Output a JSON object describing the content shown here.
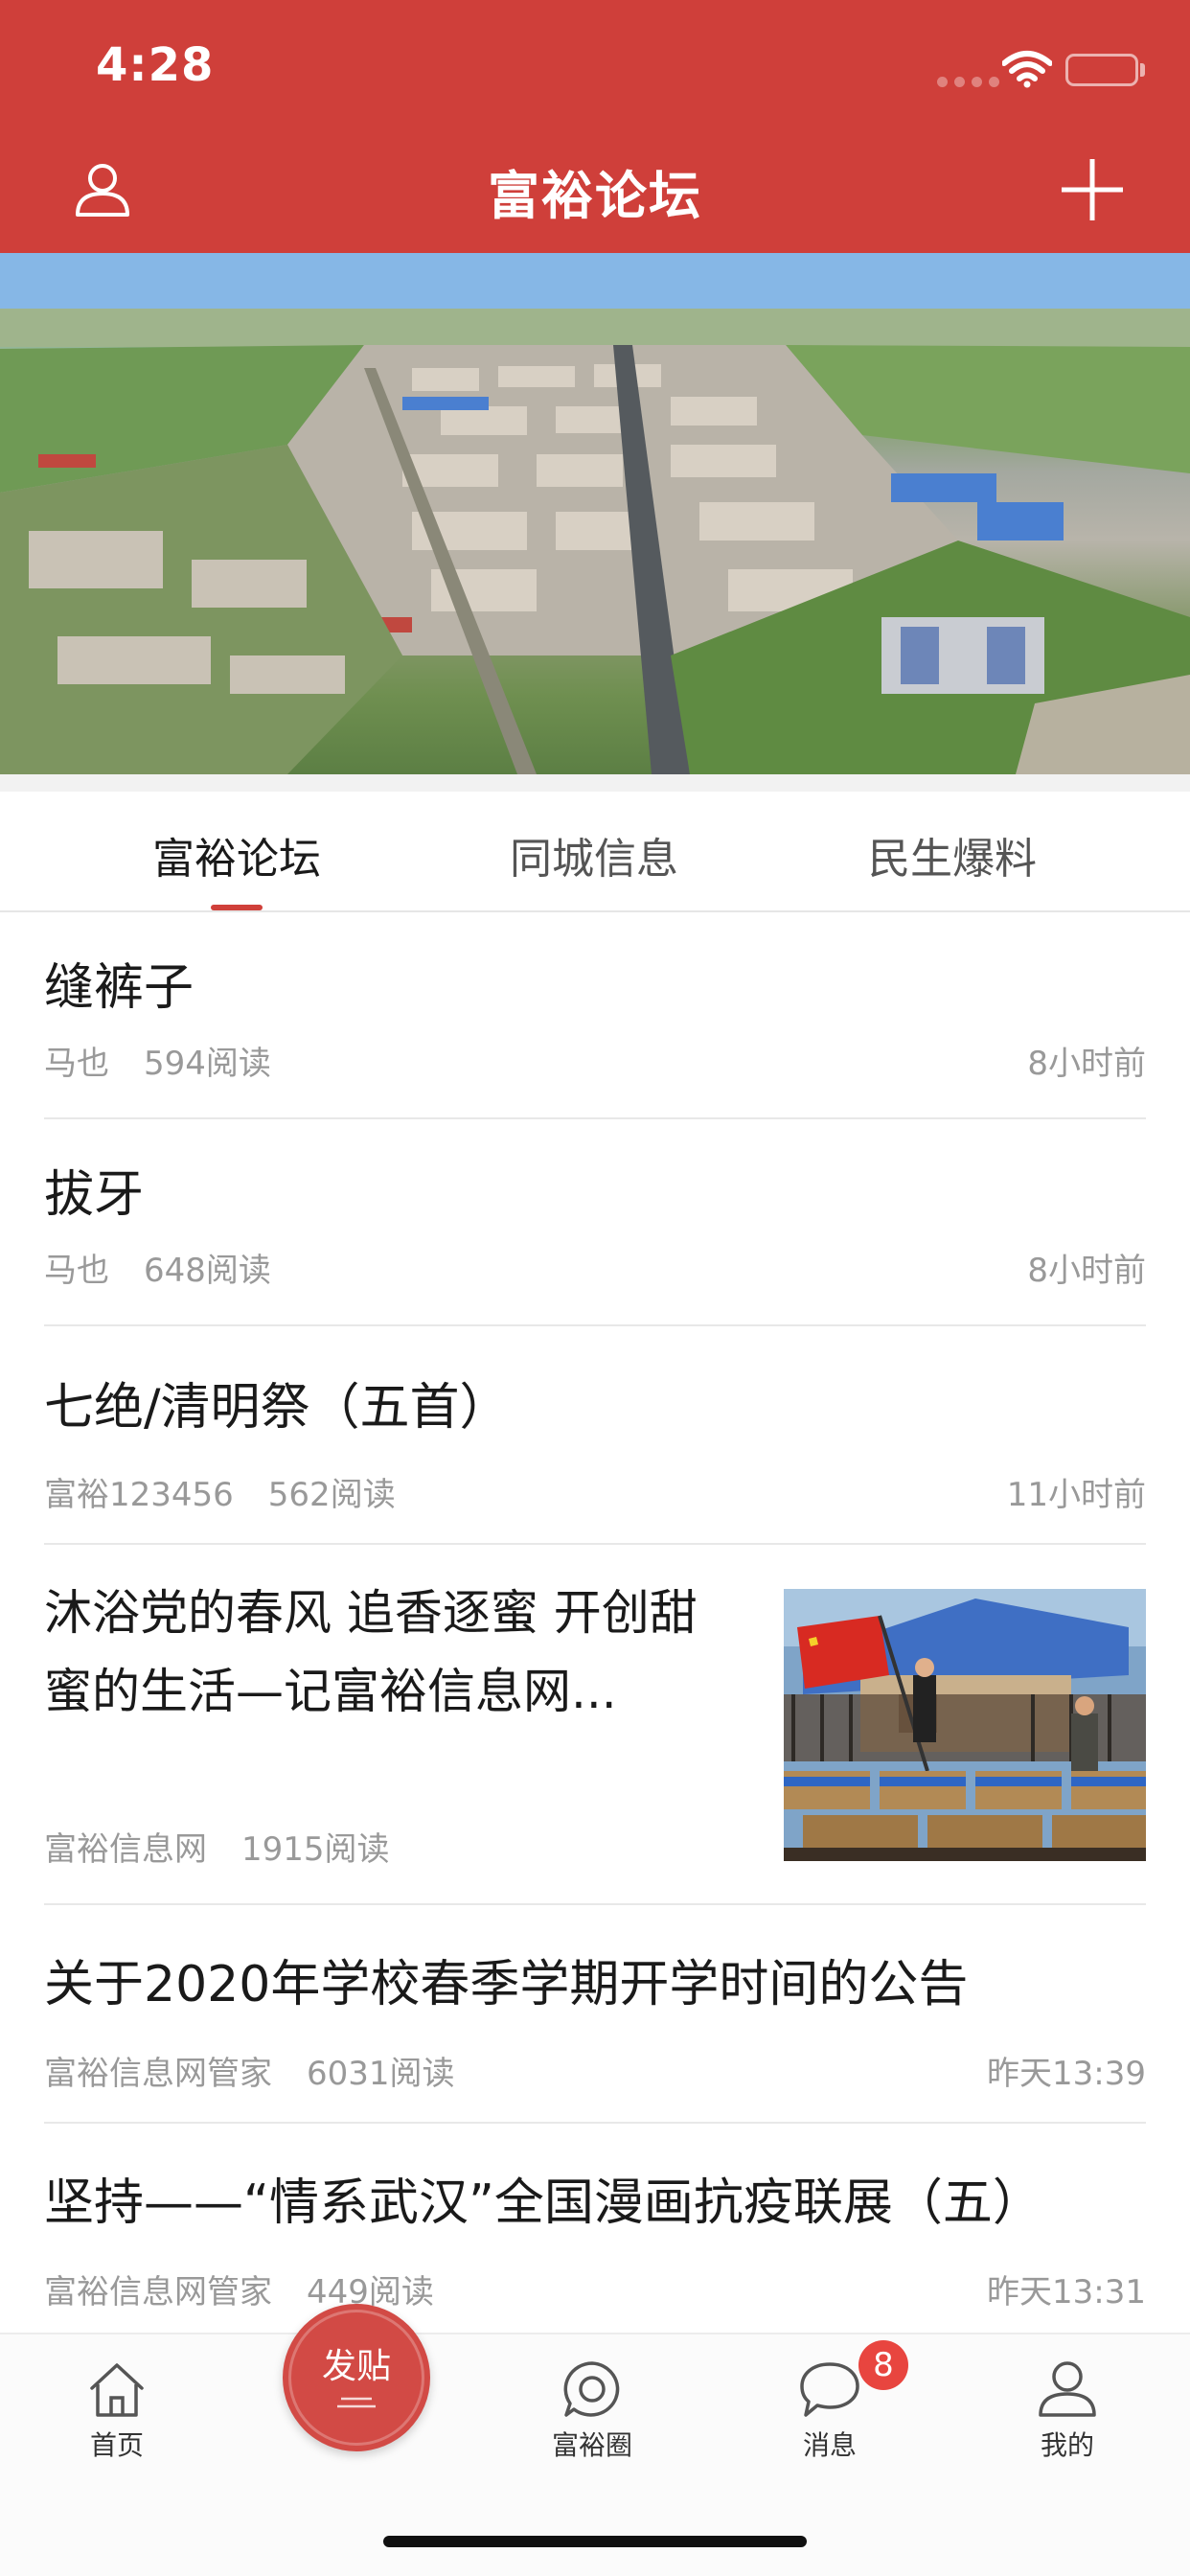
{
  "status_bar": {
    "time": "4:28"
  },
  "nav": {
    "title": "富裕论坛"
  },
  "tabs": [
    {
      "label": "富裕论坛",
      "active": true
    },
    {
      "label": "同城信息",
      "active": false
    },
    {
      "label": "民生爆料",
      "active": false
    }
  ],
  "posts": [
    {
      "title": "缝裤子",
      "author": "马也",
      "reads": "594阅读",
      "time": "8小时前"
    },
    {
      "title": "拔牙",
      "author": "马也",
      "reads": "648阅读",
      "time": "8小时前"
    },
    {
      "title": "七绝/清明祭（五首）",
      "author": "富裕123456",
      "reads": "562阅读",
      "time": "11小时前"
    },
    {
      "title": "沐浴党的春风 追香逐蜜 开创甜蜜的生活—记富裕信息网...",
      "author": "富裕信息网",
      "reads": "1915阅读",
      "time": ""
    },
    {
      "title": "关于2020年学校春季学期开学时间的公告",
      "author": "富裕信息网管家",
      "reads": "6031阅读",
      "time": "昨天13:39"
    },
    {
      "title": "坚持——“情系武汉”全国漫画抗疫联展（五）",
      "author": "富裕信息网管家",
      "reads": "449阅读",
      "time": "昨天13:31"
    }
  ],
  "tabbar": {
    "home": "首页",
    "post": "发贴",
    "circle": "富裕圈",
    "messages": "消息",
    "messages_badge": "8",
    "mine": "我的"
  },
  "icons": {
    "profile": "user-icon",
    "add": "plus-icon",
    "home": "home-icon",
    "circle": "chat-circle-icon",
    "messages": "speech-bubble-icon",
    "mine": "person-icon"
  },
  "colors": {
    "brand_red": "#cf3f3a",
    "badge_red": "#e8453f",
    "meta_gray": "#999999"
  }
}
